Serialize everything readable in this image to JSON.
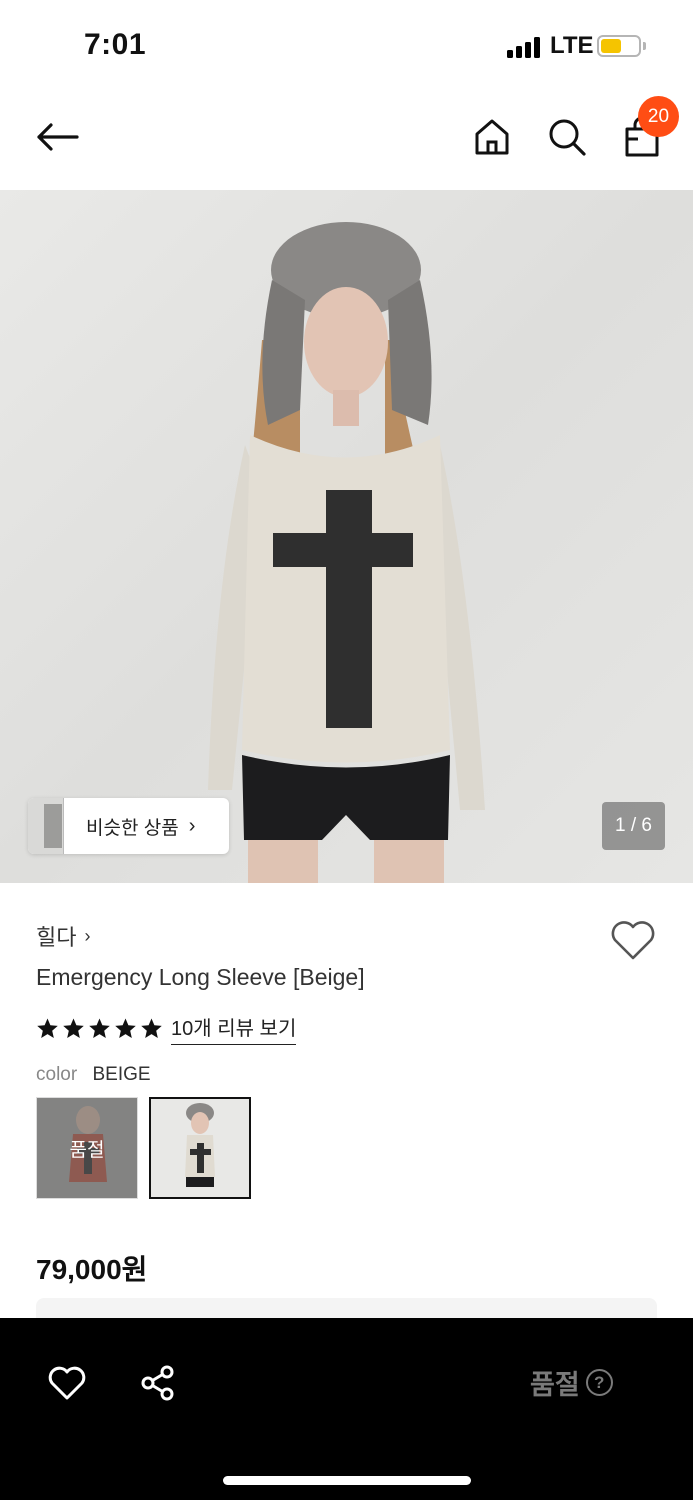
{
  "status_bar": {
    "time": "7:01",
    "network": "LTE",
    "battery_level": 0.5,
    "battery_color": "#f5c400"
  },
  "nav": {
    "back_icon": "arrow-left-icon",
    "home_icon": "home-icon",
    "search_icon": "search-icon",
    "cart_icon": "shopping-bag-icon",
    "cart_count": "20",
    "badge_color": "#ff4d14"
  },
  "gallery": {
    "similar_label": "비슷한 상품",
    "counter": "1 / 6"
  },
  "product": {
    "brand": "힐다",
    "name": "Emergency Long Sleeve [Beige]",
    "rating": 5,
    "review_link": "10개 리뷰 보기",
    "color_label": "color",
    "color_value": "BEIGE",
    "swatches": [
      {
        "status": "품절"
      },
      {
        "status": ""
      }
    ],
    "price": "79,000원"
  },
  "bottom_bar": {
    "wish_icon": "heart-icon",
    "share_icon": "share-icon",
    "action_label": "품절",
    "help_icon": "question-circle-icon"
  }
}
